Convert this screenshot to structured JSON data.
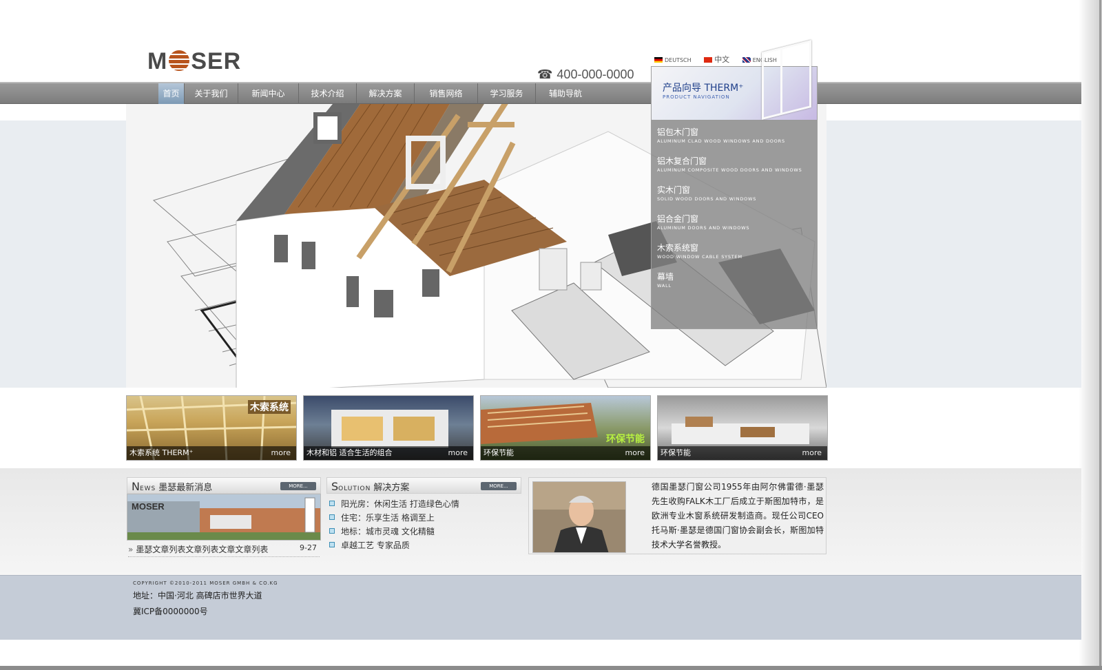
{
  "header": {
    "logo_text": "M",
    "logo_text_tail": "SER",
    "phone": "400-000-0000",
    "languages": [
      {
        "label": "DEUTSCH",
        "flag": "de"
      },
      {
        "label": "中文",
        "flag": "cn"
      },
      {
        "label": "ENGLISH",
        "flag": "en"
      }
    ]
  },
  "nav": {
    "items": [
      "首页",
      "关于我们",
      "新闻中心",
      "技术介绍",
      "解决方案",
      "销售网络",
      "学习服务",
      "辅助导航"
    ],
    "active_index": 0
  },
  "product_nav": {
    "title": "产品向导  THERM⁺",
    "subtitle": "PRODUCT NAVIGATION",
    "items": [
      {
        "cn": "铝包木门窗",
        "en": "ALUMINUM CLAD WOOD WINDOWS AND DOORS"
      },
      {
        "cn": "铝木复合门窗",
        "en": "ALUMINUM COMPOSITE WOOD DOORS AND WINDOWS"
      },
      {
        "cn": "实木门窗",
        "en": "SOLID WOOD DOORS AND WINDOWS"
      },
      {
        "cn": "铝合金门窗",
        "en": "ALUMINUM DOORS AND WINDOWS"
      },
      {
        "cn": "木索系统窗",
        "en": "WOOD WINDOW CABLE SYSTEM"
      },
      {
        "cn": "幕墙",
        "en": "WALL"
      }
    ]
  },
  "thumbs": [
    {
      "caption": "木索系统  THERM⁺",
      "more": "more",
      "tag": "木索系统"
    },
    {
      "caption": "木材和铝  适合生活的组合",
      "more": "more",
      "tag": ""
    },
    {
      "caption": "环保节能",
      "more": "more",
      "tag": "环保节能"
    },
    {
      "caption": "环保节能",
      "more": "more",
      "tag": ""
    }
  ],
  "news": {
    "head_big": "N",
    "head_small": "EWS",
    "head_cn": "墨瑟最新消息",
    "more": "MORE...",
    "image_logo": "MOSER",
    "item_text": "墨瑟文章列表文章列表文章文章列表",
    "item_date": "9-27"
  },
  "solution": {
    "head_big": "S",
    "head_small": "OLUTION",
    "head_cn": "解决方案",
    "more": "MORE...",
    "items": [
      "阳光房：休闲生活 打造绿色心情",
      "住宅：乐享生活   格调至上",
      "地标：城市灵魂   文化精髓",
      "卓越工艺   专家品质"
    ]
  },
  "about": {
    "text": "德国墨瑟门窗公司1955年由阿尔佛雷德·墨瑟先生收购FALK木工厂后成立于斯图加特市，是欧洲专业木窗系统研发制造商。现任公司CEO托马斯·墨瑟是德国门窗协会副会长，斯图加特技术大学名誉教授。"
  },
  "footer": {
    "copyright": "COPYRIGHT ©2010-2011 MOSER GMBH & CO.KG",
    "address": "地址：中国·河北  高碑店市世界大道",
    "icp": "冀ICP备0000000号"
  },
  "colors": {
    "nav_bg": "#858585",
    "accent_blue": "#1f3f8a",
    "logo_orange": "#b8541d",
    "footer_bg": "#c5ccd7"
  }
}
